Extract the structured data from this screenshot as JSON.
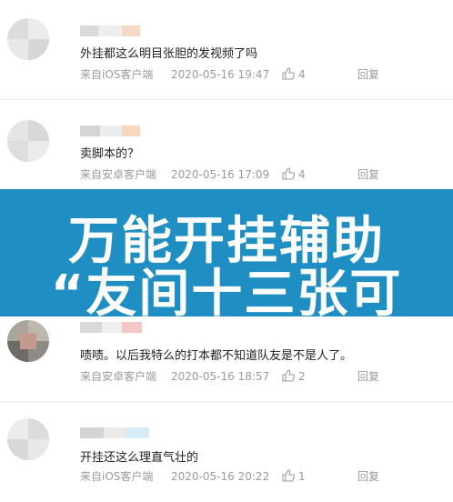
{
  "comments": [
    {
      "text": "外挂都这么明目张胆的发视频了吗",
      "source": "来自iOS客户端",
      "time": "2020-05-16 19:47",
      "likes": "4",
      "reply": "回复"
    },
    {
      "text": "卖脚本的？",
      "source": "来自安卓客户端",
      "time": "2020-05-16 17:09",
      "likes": "4",
      "reply": "回复"
    },
    {
      "text": "啧啧。以后我特么的打本都不知道队友是不是人了。",
      "source": "来自安卓客户端",
      "time": "2020-05-16 18:57",
      "likes": "2",
      "reply": "回复"
    },
    {
      "text": "开挂还这么理直气壮的",
      "source": "来自iOS客户端",
      "time": "2020-05-16 20:22",
      "likes": "1",
      "reply": "回复"
    }
  ],
  "banner": {
    "line1": "万能开挂辅助",
    "line2": "“友间十三张可"
  },
  "colors": {
    "banner_bg": "#1f8ec3",
    "meta": "#9b9b9b"
  },
  "icons": {
    "like": "thumb-up-icon"
  }
}
